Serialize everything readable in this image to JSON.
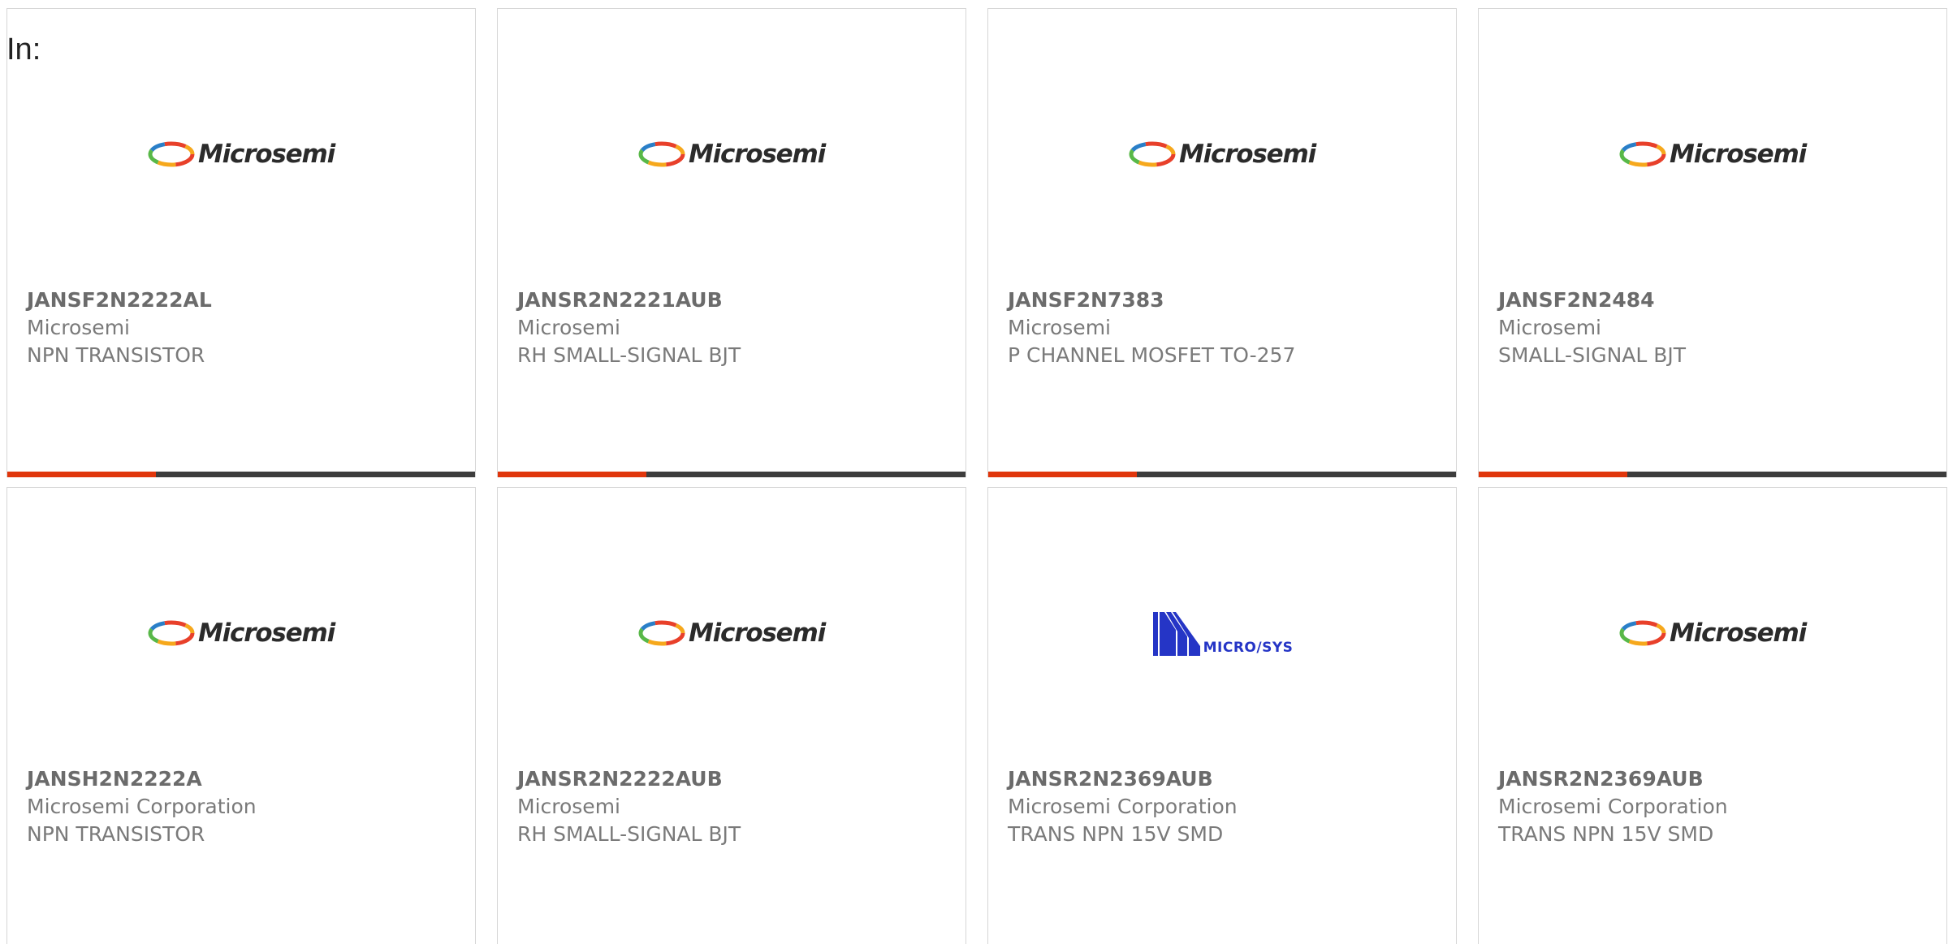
{
  "header": {
    "in_label": "In:"
  },
  "colors": {
    "accent": "#e0360c",
    "bar": "#3d3d3d",
    "border": "#d6d6d6",
    "microsys_blue": "#2535c6"
  },
  "cards": [
    {
      "part": "JANSF2N2222AL",
      "manufacturer": "Microsemi",
      "description": "NPN TRANSISTOR",
      "logo": "microsemi-logo",
      "logo_text": "Microsemi"
    },
    {
      "part": "JANSR2N2221AUB",
      "manufacturer": "Microsemi",
      "description": "RH SMALL-SIGNAL BJT",
      "logo": "microsemi-logo",
      "logo_text": "Microsemi"
    },
    {
      "part": "JANSF2N7383",
      "manufacturer": "Microsemi",
      "description": "P CHANNEL MOSFET TO-257",
      "logo": "microsemi-logo",
      "logo_text": "Microsemi"
    },
    {
      "part": "JANSF2N2484",
      "manufacturer": "Microsemi",
      "description": "SMALL-SIGNAL BJT",
      "logo": "microsemi-logo",
      "logo_text": "Microsemi"
    },
    {
      "part": "JANSH2N2222A",
      "manufacturer": "Microsemi Corporation",
      "description": "NPN TRANSISTOR",
      "logo": "microsemi-logo",
      "logo_text": "Microsemi"
    },
    {
      "part": "JANSR2N2222AUB",
      "manufacturer": "Microsemi",
      "description": "RH SMALL-SIGNAL BJT",
      "logo": "microsemi-logo",
      "logo_text": "Microsemi"
    },
    {
      "part": "JANSR2N2369AUB",
      "manufacturer": "Microsemi Corporation",
      "description": "TRANS NPN 15V SMD",
      "logo": "microsys-logo",
      "logo_text": "MICRO/SYS"
    },
    {
      "part": "JANSR2N2369AUB",
      "manufacturer": "Microsemi Corporation",
      "description": "TRANS NPN 15V SMD",
      "logo": "microsemi-logo",
      "logo_text": "Microsemi"
    }
  ]
}
